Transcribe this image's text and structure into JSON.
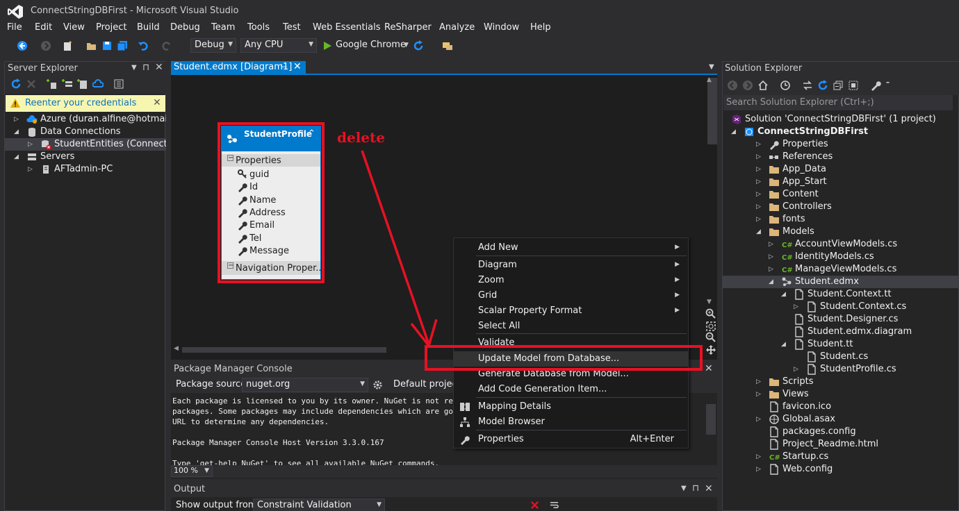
{
  "window": {
    "title": "ConnectStringDBFirst - Microsoft Visual Studio"
  },
  "menu": [
    "File",
    "Edit",
    "View",
    "Project",
    "Build",
    "Debug",
    "Team",
    "Tools",
    "Test",
    "Web Essentials",
    "ReSharper",
    "Analyze",
    "Window",
    "Help"
  ],
  "toolbar": {
    "configuration": "Debug",
    "platform": "Any CPU",
    "run_target": "Google Chrome"
  },
  "server_explorer": {
    "title": "Server Explorer",
    "warning": "Reenter your credentials",
    "items": [
      {
        "label": "Azure (duran.alfine@hotmail.co",
        "level": 0,
        "icon": "azure-icon"
      },
      {
        "label": "Data Connections",
        "level": 0,
        "icon": "database-icon"
      },
      {
        "label": "StudentEntities (ConnectStrin",
        "level": 1,
        "icon": "db-connection-error-icon"
      },
      {
        "label": "Servers",
        "level": 0,
        "icon": "servers-icon"
      },
      {
        "label": "AFTadmin-PC",
        "level": 1,
        "icon": "server-icon"
      }
    ]
  },
  "document_tab": {
    "label": "Student.edmx [Diagram1]"
  },
  "designer": {
    "entity": {
      "name": "StudentProfile",
      "section": "Properties",
      "properties": [
        "guid",
        "Id",
        "Name",
        "Address",
        "Email",
        "Tel",
        "Message"
      ],
      "nav_section": "Navigation Proper..."
    },
    "annotation": "delete"
  },
  "context_menu": {
    "items": [
      {
        "label": "Add New",
        "sub": true
      },
      {
        "label": "Diagram",
        "sub": true
      },
      {
        "label": "Zoom",
        "sub": true
      },
      {
        "label": "Grid",
        "sub": true
      },
      {
        "label": "Scalar Property Format",
        "sub": true
      },
      {
        "label": "Select All"
      },
      {
        "label": "Validate"
      },
      {
        "label": "Update Model from Database..."
      },
      {
        "label": "Generate Database from Model..."
      },
      {
        "label": "Add Code Generation Item..."
      },
      {
        "label": "Mapping Details"
      },
      {
        "label": "Model Browser"
      },
      {
        "label": "Properties",
        "shortcut": "Alt+Enter"
      }
    ]
  },
  "package_console": {
    "title": "Package Manager Console",
    "source_label": "Package source:",
    "source_value": "nuget.org",
    "default_project_label": "Default project",
    "lines": [
      "Each package is licensed to you by its owner. NuGet is not responsi",
      "packages. Some packages may include dependencies which are governed",
      "URL to determine any dependencies.",
      "",
      "Package Manager Console Host Version 3.3.0.167",
      "",
      "Type 'get-help NuGet' to see all available NuGet commands."
    ],
    "zoom": "100 %"
  },
  "output": {
    "title": "Output",
    "show_from_label": "Show output from:",
    "show_from_value": "Constraint Validation"
  },
  "solution_explorer": {
    "title": "Solution Explorer",
    "search_placeholder": "Search Solution Explorer (Ctrl+;)",
    "items": [
      {
        "label": "Solution 'ConnectStringDBFirst' (1 project)",
        "level": 0,
        "icon": "solution-icon",
        "tri": ""
      },
      {
        "label": "ConnectStringDBFirst",
        "level": 0,
        "icon": "web-project-icon",
        "tri": "open",
        "bold": true
      },
      {
        "label": "Properties",
        "level": 1,
        "icon": "wrench-icon",
        "tri": "closed"
      },
      {
        "label": "References",
        "level": 1,
        "icon": "references-icon",
        "tri": "closed"
      },
      {
        "label": "App_Data",
        "level": 1,
        "icon": "folder-icon",
        "tri": "closed"
      },
      {
        "label": "App_Start",
        "level": 1,
        "icon": "folder-icon",
        "tri": "closed"
      },
      {
        "label": "Content",
        "level": 1,
        "icon": "folder-icon",
        "tri": "closed"
      },
      {
        "label": "Controllers",
        "level": 1,
        "icon": "folder-icon",
        "tri": "closed"
      },
      {
        "label": "fonts",
        "level": 1,
        "icon": "folder-icon",
        "tri": "closed"
      },
      {
        "label": "Models",
        "level": 1,
        "icon": "folder-icon",
        "tri": "open"
      },
      {
        "label": "AccountViewModels.cs",
        "level": 2,
        "icon": "csharp-icon",
        "tri": "closed"
      },
      {
        "label": "IdentityModels.cs",
        "level": 2,
        "icon": "csharp-icon",
        "tri": "closed"
      },
      {
        "label": "ManageViewModels.cs",
        "level": 2,
        "icon": "csharp-icon",
        "tri": "closed"
      },
      {
        "label": "Student.edmx",
        "level": 2,
        "icon": "edmx-icon",
        "tri": "open",
        "selected": true
      },
      {
        "label": "Student.Context.tt",
        "level": 3,
        "icon": "file-icon",
        "tri": "open"
      },
      {
        "label": "Student.Context.cs",
        "level": 4,
        "icon": "file-icon",
        "tri": "closed"
      },
      {
        "label": "Student.Designer.cs",
        "level": 3,
        "icon": "file-icon",
        "tri": ""
      },
      {
        "label": "Student.edmx.diagram",
        "level": 3,
        "icon": "file-icon",
        "tri": ""
      },
      {
        "label": "Student.tt",
        "level": 3,
        "icon": "file-icon",
        "tri": "open"
      },
      {
        "label": "Student.cs",
        "level": 4,
        "icon": "file-icon",
        "tri": ""
      },
      {
        "label": "StudentProfile.cs",
        "level": 4,
        "icon": "file-icon",
        "tri": "closed"
      },
      {
        "label": "Scripts",
        "level": 1,
        "icon": "folder-icon",
        "tri": "closed"
      },
      {
        "label": "Views",
        "level": 1,
        "icon": "folder-icon",
        "tri": "closed"
      },
      {
        "label": "favicon.ico",
        "level": 1,
        "icon": "file-icon",
        "tri": ""
      },
      {
        "label": "Global.asax",
        "level": 1,
        "icon": "global-icon",
        "tri": "closed"
      },
      {
        "label": "packages.config",
        "level": 1,
        "icon": "file-icon",
        "tri": ""
      },
      {
        "label": "Project_Readme.html",
        "level": 1,
        "icon": "file-icon",
        "tri": ""
      },
      {
        "label": "Startup.cs",
        "level": 1,
        "icon": "csharp-icon",
        "tri": "closed"
      },
      {
        "label": "Web.config",
        "level": 1,
        "icon": "file-icon",
        "tri": "closed"
      }
    ]
  },
  "colors": {
    "accent": "#007acc",
    "annotation": "#e81123",
    "folder": "#dcb67a",
    "csharp": "#68b723"
  }
}
